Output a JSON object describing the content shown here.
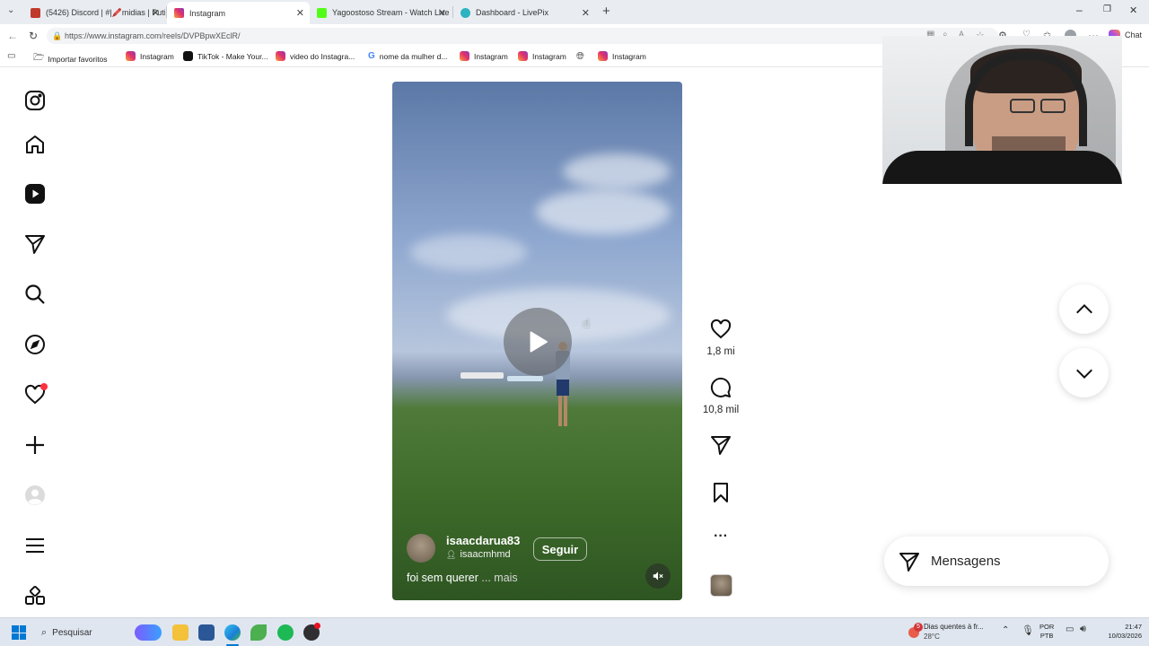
{
  "browser": {
    "tabs": [
      {
        "title": "(5426) Discord | #|🖍️midias | Puti",
        "color": "#5865f2"
      },
      {
        "title": "Instagram",
        "color": "#e1306c"
      },
      {
        "title": "Yagoostoso Stream - Watch Live o",
        "color": "#53fc18"
      },
      {
        "title": "Dashboard - LivePix",
        "color": "#2bb3c0"
      }
    ],
    "url": "https://www.instagram.com/reels/DVPBpwXEclR/",
    "chat_label": "Chat",
    "bookmarks": [
      "Importar favoritos",
      "Instagram",
      "TikTok - Make Your...",
      "video do Instagra...",
      "nome da mulher d...",
      "Instagram",
      "Instagram",
      "Instagram"
    ]
  },
  "reel": {
    "username": "isaacdarua83",
    "audio_user": "isaacmhmd",
    "follow_label": "Seguir",
    "caption": "foi sem querer",
    "more_label": "... mais",
    "likes": "1,8 mi",
    "comments": "10,8 mil"
  },
  "messages_label": "Mensagens",
  "taskbar": {
    "search_placeholder": "Pesquisar",
    "weather_title": "Dias quentes à fr...",
    "weather_temp": "28°C",
    "weather_badge": "5",
    "lang1": "POR",
    "lang2": "PTB",
    "time": "21:47",
    "date": "10/03/2026"
  }
}
